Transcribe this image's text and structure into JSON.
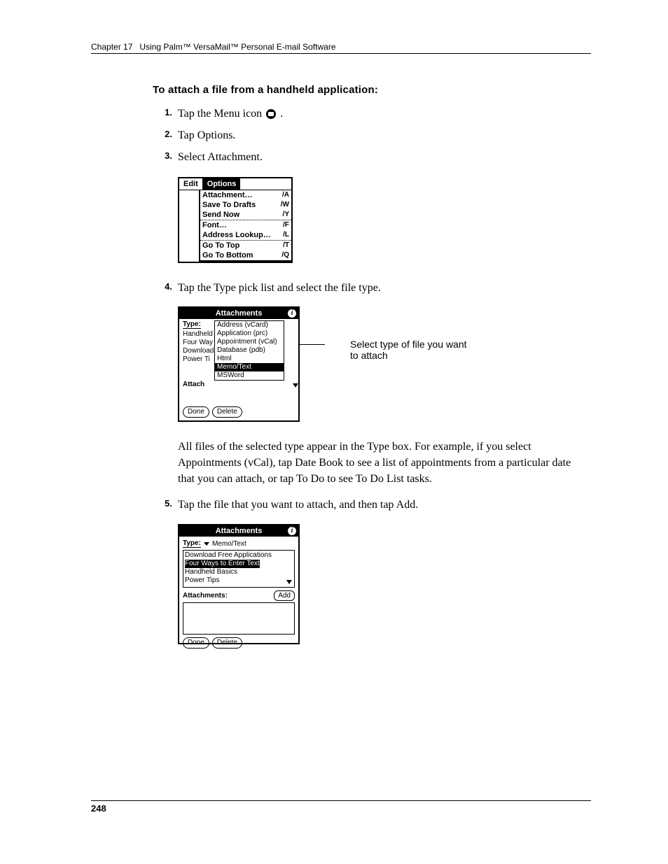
{
  "header": {
    "chapter": "Chapter 17",
    "title": "Using Palm™ VersaMail™ Personal E-mail Software"
  },
  "section_title": "To attach a file from a handheld application:",
  "steps": {
    "s1": {
      "num": "1.",
      "text_before": "Tap the Menu icon ",
      "text_after": "."
    },
    "s2": {
      "num": "2.",
      "text": "Tap Options."
    },
    "s3": {
      "num": "3.",
      "text": "Select Attachment."
    },
    "s4": {
      "num": "4.",
      "text": "Tap the Type pick list and select the file type."
    },
    "s4_para": "All files of the selected type appear in the Type box. For example, if you select Appointments (vCal), tap Date Book to see a list of appointments from a particular date that you can attach, or tap To Do to see To Do List tasks.",
    "s5": {
      "num": "5.",
      "text": "Tap the file that you want to attach, and then tap Add."
    }
  },
  "fig1": {
    "menu_edit": "Edit",
    "menu_options": "Options",
    "items": {
      "attachment": {
        "label": "Attachment…",
        "sc": "/A"
      },
      "save_drafts": {
        "label": "Save To Drafts",
        "sc": "/W"
      },
      "send_now": {
        "label": "Send Now",
        "sc": "/Y"
      },
      "font": {
        "label": "Font…",
        "sc": "/F"
      },
      "addr_lookup": {
        "label": "Address Lookup…",
        "sc": "/L"
      },
      "go_top": {
        "label": "Go To Top",
        "sc": "/T"
      },
      "go_bottom": {
        "label": "Go To Bottom",
        "sc": "/Q"
      }
    }
  },
  "fig2": {
    "title": "Attachments",
    "type_label": "Type:",
    "attach_label": "Attach",
    "bg_items": [
      "Handheld",
      "Four Way",
      "Download",
      "Power Ti"
    ],
    "dropdown": [
      "Address (vCard)",
      "Application (prc)",
      "Appointment (vCal)",
      "Database (pdb)",
      "Html",
      "Memo/Text",
      "MSWord"
    ],
    "selected": "Memo/Text",
    "done": "Done",
    "delete": "Delete",
    "callout": "Select type of file you want to attach"
  },
  "fig3": {
    "title": "Attachments",
    "type_label": "Type:",
    "type_value": "Memo/Text",
    "list": [
      "Download Free Applications",
      "Four Ways to Enter Text",
      "Handheld Basics",
      "Power Tips"
    ],
    "selected": "Four Ways to Enter Text",
    "attach_label": "Attachments:",
    "add": "Add",
    "done": "Done",
    "delete": "Delete"
  },
  "page_number": "248"
}
